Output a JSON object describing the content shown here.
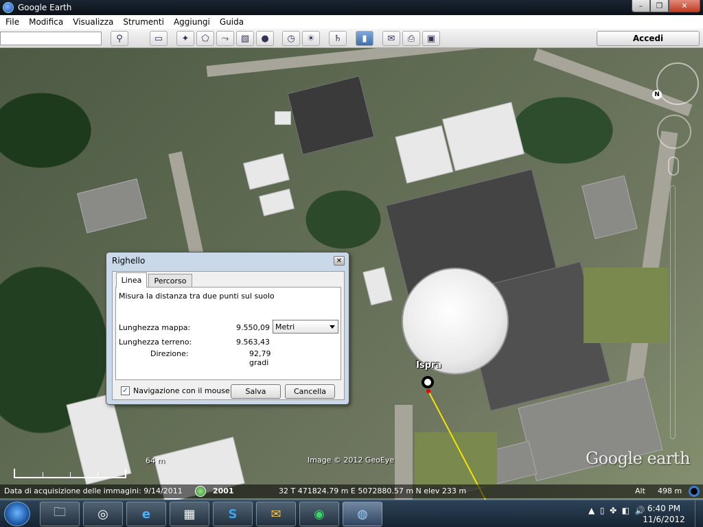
{
  "window": {
    "title": "Google Earth",
    "buttons": [
      "–",
      "❐",
      "✕"
    ]
  },
  "menu": [
    "File",
    "Modifica",
    "Visualizza",
    "Strumenti",
    "Aggiungi",
    "Guida"
  ],
  "toolbar": {
    "search_placeholder": "",
    "login_label": "Accedi",
    "buttons": [
      "search-icon",
      "sidebar-icon",
      "placemark-icon",
      "polygon-icon",
      "path-icon",
      "overlay-icon",
      "tour-icon",
      "history-icon",
      "sunlight-icon",
      "planets-icon",
      "ruler-icon",
      "email-icon",
      "print-icon",
      "save-image-icon"
    ]
  },
  "map": {
    "place_label": "Ispra",
    "copyright": "Image © 2012 GeoEye",
    "logo": "Google earth",
    "scale_label": "64 m",
    "compass_letter": "N"
  },
  "status": {
    "acquisition": "Data di acquisizione delle immagini: 9/14/2011",
    "year": "2001",
    "coords": "32 T 471824.79 m E 5072880.57 m N elev  233 m",
    "alt_label": "Alt",
    "alt_value": "498 m"
  },
  "ruler": {
    "title": "Righello",
    "tabs": [
      "Linea",
      "Percorso"
    ],
    "active_tab": "Linea",
    "description": "Misura la distanza tra due punti sul suolo",
    "map_length_label": "Lunghezza mappa:",
    "map_length_value": "9.550,09",
    "unit": "Metri",
    "ground_length_label": "Lunghezza terreno:",
    "ground_length_value": "9.563,43",
    "heading_label": "Direzione:",
    "heading_value": "92,79 gradi",
    "mouse_nav_label": "Navigazione con il mouse",
    "mouse_nav_checked": true,
    "save_label": "Salva",
    "cancel_label": "Cancella"
  },
  "taskbar": {
    "apps": [
      "explorer",
      "network-map",
      "internet-explorer",
      "photo-viewer",
      "skype",
      "outlook",
      "green-app",
      "google-earth"
    ],
    "time": "6:40 PM",
    "date": "11/6/2012"
  }
}
